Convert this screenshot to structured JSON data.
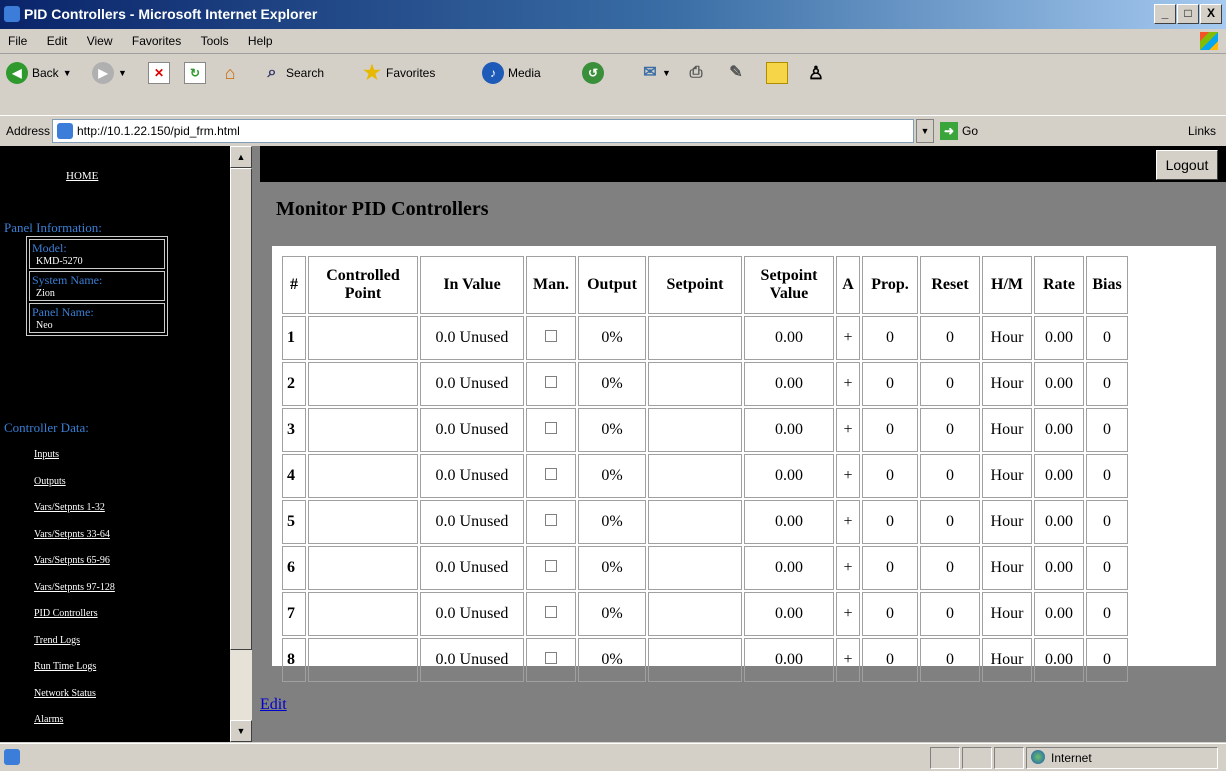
{
  "window": {
    "title": "PID Controllers - Microsoft Internet Explorer",
    "buttons": [
      "_",
      "□",
      "X"
    ]
  },
  "menu": [
    "File",
    "Edit",
    "View",
    "Favorites",
    "Tools",
    "Help"
  ],
  "toolbar": {
    "back": "Back",
    "search": "Search",
    "favorites": "Favorites",
    "media": "Media"
  },
  "address": {
    "label": "Address",
    "url": "http://10.1.22.150/pid_frm.html",
    "go": "Go",
    "links": "Links"
  },
  "sidebar": {
    "home": "HOME",
    "panel_heading": "Panel Information:",
    "model_label": "Model:",
    "model_value": "KMD-5270",
    "system_label": "System Name:",
    "system_value": "Zion",
    "panel_label": "Panel Name:",
    "panel_value": "Neo",
    "controller_heading": "Controller Data:",
    "links": [
      "Inputs",
      "Outputs",
      "Vars/Setpnts 1-32",
      "Vars/Setpnts 33-64",
      "Vars/Setpnts 65-96",
      "Vars/Setpnts 97-128",
      "PID Controllers",
      "Trend Logs",
      "Run Time Logs",
      "Network Status",
      "Alarms"
    ]
  },
  "main": {
    "logout": "Logout",
    "title": "Monitor PID Controllers",
    "headers": [
      "#",
      "Controlled Point",
      "In Value",
      "Man.",
      "Output",
      "Setpoint",
      "Setpoint Value",
      "A",
      "Prop.",
      "Reset",
      "H/M",
      "Rate",
      "Bias"
    ],
    "rows": [
      {
        "num": "1",
        "point": "",
        "in_value": "0.0 Unused",
        "manual": false,
        "output": "0%",
        "setpoint": "",
        "setpoint_value": "0.00",
        "action": "+",
        "prop": "0",
        "reset": "0",
        "hm": "Hour",
        "rate": "0.00",
        "bias": "0"
      },
      {
        "num": "2",
        "point": "",
        "in_value": "0.0 Unused",
        "manual": false,
        "output": "0%",
        "setpoint": "",
        "setpoint_value": "0.00",
        "action": "+",
        "prop": "0",
        "reset": "0",
        "hm": "Hour",
        "rate": "0.00",
        "bias": "0"
      },
      {
        "num": "3",
        "point": "",
        "in_value": "0.0 Unused",
        "manual": false,
        "output": "0%",
        "setpoint": "",
        "setpoint_value": "0.00",
        "action": "+",
        "prop": "0",
        "reset": "0",
        "hm": "Hour",
        "rate": "0.00",
        "bias": "0"
      },
      {
        "num": "4",
        "point": "",
        "in_value": "0.0 Unused",
        "manual": false,
        "output": "0%",
        "setpoint": "",
        "setpoint_value": "0.00",
        "action": "+",
        "prop": "0",
        "reset": "0",
        "hm": "Hour",
        "rate": "0.00",
        "bias": "0"
      },
      {
        "num": "5",
        "point": "",
        "in_value": "0.0 Unused",
        "manual": false,
        "output": "0%",
        "setpoint": "",
        "setpoint_value": "0.00",
        "action": "+",
        "prop": "0",
        "reset": "0",
        "hm": "Hour",
        "rate": "0.00",
        "bias": "0"
      },
      {
        "num": "6",
        "point": "",
        "in_value": "0.0 Unused",
        "manual": false,
        "output": "0%",
        "setpoint": "",
        "setpoint_value": "0.00",
        "action": "+",
        "prop": "0",
        "reset": "0",
        "hm": "Hour",
        "rate": "0.00",
        "bias": "0"
      },
      {
        "num": "7",
        "point": "",
        "in_value": "0.0 Unused",
        "manual": false,
        "output": "0%",
        "setpoint": "",
        "setpoint_value": "0.00",
        "action": "+",
        "prop": "0",
        "reset": "0",
        "hm": "Hour",
        "rate": "0.00",
        "bias": "0"
      },
      {
        "num": "8",
        "point": "",
        "in_value": "0.0 Unused",
        "manual": false,
        "output": "0%",
        "setpoint": "",
        "setpoint_value": "0.00",
        "action": "+",
        "prop": "0",
        "reset": "0",
        "hm": "Hour",
        "rate": "0.00",
        "bias": "0"
      }
    ],
    "edit": "Edit"
  },
  "status": {
    "zone": "Internet"
  },
  "colors": {
    "title_gradient_start": "#0a246a",
    "sidebar_heading": "#3b7fd6",
    "frame_bg": "#808080",
    "link": "#0000cc"
  }
}
